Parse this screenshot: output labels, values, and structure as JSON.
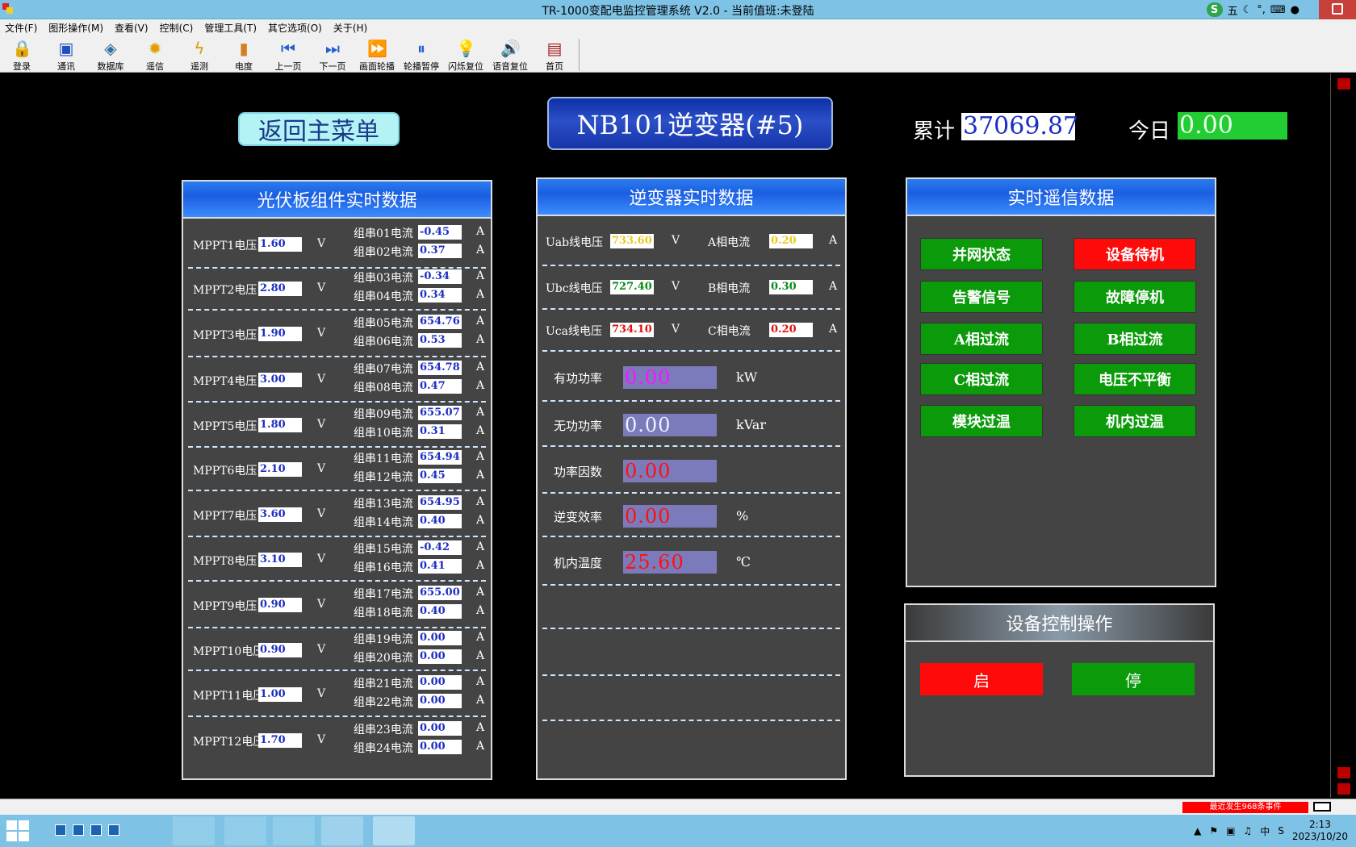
{
  "window": {
    "title": "TR-1000变配电监控管理系统 V2.0 - 当前值班:未登陆"
  },
  "ime": {
    "mode": "五"
  },
  "menu": [
    "文件(F)",
    "图形操作(M)",
    "查看(V)",
    "控制(C)",
    "管理工具(T)",
    "其它选项(O)",
    "关于(H)"
  ],
  "toolbar": [
    {
      "label": "登录",
      "icon": "login-icon"
    },
    {
      "label": "通讯",
      "icon": "monitor-icon"
    },
    {
      "label": "数据库",
      "icon": "database-icon"
    },
    {
      "label": "遥信",
      "icon": "sun-icon"
    },
    {
      "label": "遥测",
      "icon": "lightning-icon"
    },
    {
      "label": "电度",
      "icon": "meter-icon"
    },
    {
      "label": "上一页",
      "icon": "prev-page-icon"
    },
    {
      "label": "下一页",
      "icon": "next-page-icon"
    },
    {
      "label": "画面轮播",
      "icon": "fast-forward-icon"
    },
    {
      "label": "轮播暂停",
      "icon": "pause-icon"
    },
    {
      "label": "闪烁复位",
      "icon": "bulb-icon"
    },
    {
      "label": "语音复位",
      "icon": "speaker-icon"
    },
    {
      "label": "首页",
      "icon": "home-book-icon"
    }
  ],
  "header": {
    "back_label": "返回主菜单",
    "device_title": "NB101逆变器(#5)",
    "total_label": "累计",
    "total_value": "37069.87",
    "today_label": "今日",
    "today_value": "0.00"
  },
  "pv": {
    "title": "光伏板组件实时数据",
    "unit_v": "V",
    "unit_a": "A",
    "mppt": [
      {
        "label": "MPPT1电压",
        "value": "1.60",
        "strings": [
          {
            "label": "组串01电流",
            "value": "-0.45"
          },
          {
            "label": "组串02电流",
            "value": "0.37"
          }
        ]
      },
      {
        "label": "MPPT2电压",
        "value": "2.80",
        "strings": [
          {
            "label": "组串03电流",
            "value": "-0.34"
          },
          {
            "label": "组串04电流",
            "value": "0.34"
          }
        ]
      },
      {
        "label": "MPPT3电压",
        "value": "1.90",
        "strings": [
          {
            "label": "组串05电流",
            "value": "654.76"
          },
          {
            "label": "组串06电流",
            "value": "0.53"
          }
        ]
      },
      {
        "label": "MPPT4电压",
        "value": "3.00",
        "strings": [
          {
            "label": "组串07电流",
            "value": "654.78"
          },
          {
            "label": "组串08电流",
            "value": "0.47"
          }
        ]
      },
      {
        "label": "MPPT5电压",
        "value": "1.80",
        "strings": [
          {
            "label": "组串09电流",
            "value": "655.07"
          },
          {
            "label": "组串10电流",
            "value": "0.31"
          }
        ]
      },
      {
        "label": "MPPT6电压",
        "value": "2.10",
        "strings": [
          {
            "label": "组串11电流",
            "value": "654.94"
          },
          {
            "label": "组串12电流",
            "value": "0.45"
          }
        ]
      },
      {
        "label": "MPPT7电压",
        "value": "3.60",
        "strings": [
          {
            "label": "组串13电流",
            "value": "654.95"
          },
          {
            "label": "组串14电流",
            "value": "0.40"
          }
        ]
      },
      {
        "label": "MPPT8电压",
        "value": "3.10",
        "strings": [
          {
            "label": "组串15电流",
            "value": "-0.42"
          },
          {
            "label": "组串16电流",
            "value": "0.41"
          }
        ]
      },
      {
        "label": "MPPT9电压",
        "value": "0.90",
        "strings": [
          {
            "label": "组串17电流",
            "value": "655.00"
          },
          {
            "label": "组串18电流",
            "value": "0.40"
          }
        ]
      },
      {
        "label": "MPPT10电压",
        "value": "0.90",
        "strings": [
          {
            "label": "组串19电流",
            "value": "0.00"
          },
          {
            "label": "组串20电流",
            "value": "0.00"
          }
        ]
      },
      {
        "label": "MPPT11电压",
        "value": "1.00",
        "strings": [
          {
            "label": "组串21电流",
            "value": "0.00"
          },
          {
            "label": "组串22电流",
            "value": "0.00"
          }
        ]
      },
      {
        "label": "MPPT12电压",
        "value": "1.70",
        "strings": [
          {
            "label": "组串23电流",
            "value": "0.00"
          },
          {
            "label": "组串24电流",
            "value": "0.00"
          }
        ]
      }
    ]
  },
  "inverter": {
    "title": "逆变器实时数据",
    "lines": [
      {
        "v_label": "Uab线电压",
        "v_value": "733.60",
        "v_color": "#e8c81e",
        "v_unit": "V",
        "i_label": "A相电流",
        "i_value": "0.20",
        "i_color": "#e8c81e",
        "i_unit": "A"
      },
      {
        "v_label": "Ubc线电压",
        "v_value": "727.40",
        "v_color": "#0a8a1a",
        "v_unit": "V",
        "i_label": "B相电流",
        "i_value": "0.30",
        "i_color": "#0a8a1a",
        "i_unit": "A"
      },
      {
        "v_label": "Uca线电压",
        "v_value": "734.10",
        "v_color": "#e01010",
        "v_unit": "V",
        "i_label": "C相电流",
        "i_value": "0.20",
        "i_color": "#e01010",
        "i_unit": "A"
      }
    ],
    "power": [
      {
        "label": "有功功率",
        "value": "0.00",
        "unit": "kW",
        "color": "#ff10ff"
      },
      {
        "label": "无功功率",
        "value": "0.00",
        "unit": "kVar",
        "color": "#e6f4ff"
      },
      {
        "label": "功率因数",
        "value": "0.00",
        "unit": "",
        "color": "#ff1010"
      },
      {
        "label": "逆变效率",
        "value": "0.00",
        "unit": "%",
        "color": "#ff1010"
      },
      {
        "label": "机内温度",
        "value": "25.60",
        "unit": "℃",
        "color": "#ff1010"
      }
    ]
  },
  "signals": {
    "title": "实时遥信数据",
    "items": [
      {
        "label": "并网状态",
        "color": "#0a9a0a"
      },
      {
        "label": "设备待机",
        "color": "#ff0a0a"
      },
      {
        "label": "告警信号",
        "color": "#0a9a0a"
      },
      {
        "label": "故障停机",
        "color": "#0a9a0a"
      },
      {
        "label": "A相过流",
        "color": "#0a9a0a"
      },
      {
        "label": "B相过流",
        "color": "#0a9a0a"
      },
      {
        "label": "C相过流",
        "color": "#0a9a0a"
      },
      {
        "label": "电压不平衡",
        "color": "#0a9a0a"
      },
      {
        "label": "模块过温",
        "color": "#0a9a0a"
      },
      {
        "label": "机内过温",
        "color": "#0a9a0a"
      }
    ]
  },
  "control": {
    "title": "设备控制操作",
    "start_label": "启",
    "start_color": "#ff0a0a",
    "stop_label": "停",
    "stop_color": "#0a9a0a"
  },
  "status": {
    "alert_text": "最近发生968条事件"
  },
  "taskbar": {
    "time": "2:13",
    "date": "2023/10/20",
    "ime_lang": "中"
  }
}
